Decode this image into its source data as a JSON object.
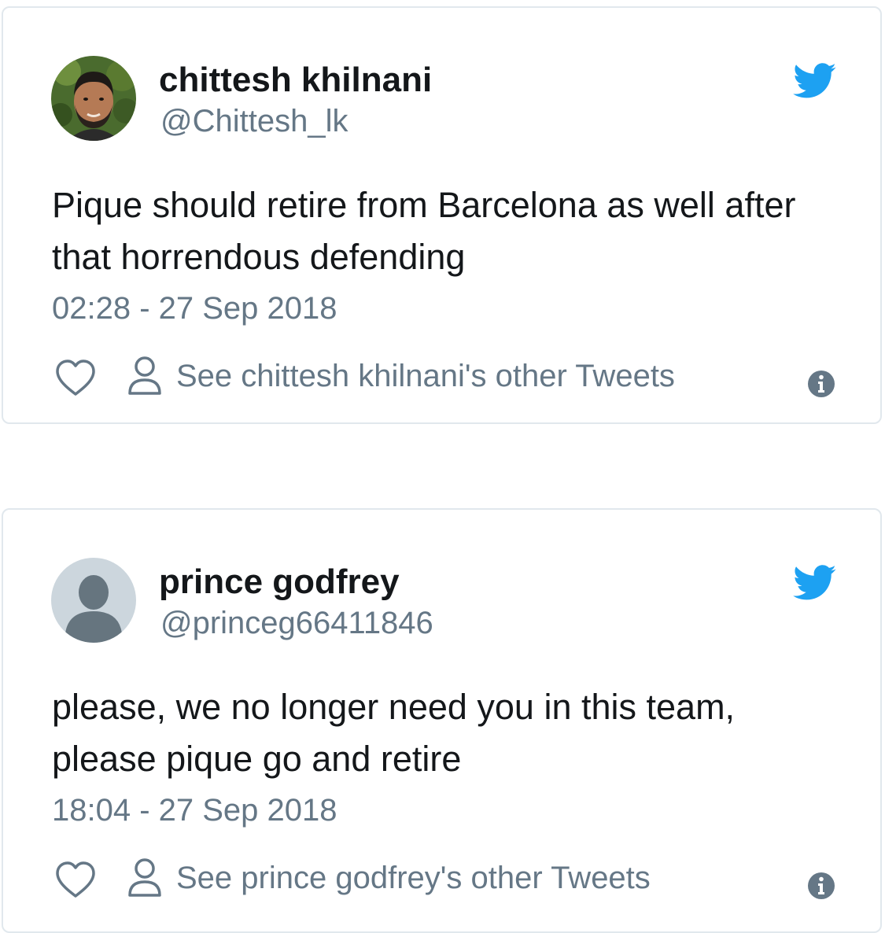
{
  "tweets": [
    {
      "display_name": "chittesh khilnani",
      "handle": "@Chittesh_lk",
      "text": "Pique should retire from Barcelona as well after that horrendous defending",
      "timestamp": "02:28 - 27 Sep 2018",
      "profile_link": "See chittesh khilnani's other Tweets"
    },
    {
      "display_name": "prince godfrey",
      "handle": "@princeg66411846",
      "text": "please, we no longer need you in this team, please pique go and retire",
      "timestamp": "18:04 - 27 Sep 2018",
      "profile_link": "See prince godfrey's other Tweets"
    }
  ],
  "icons": {
    "brand": "twitter-bird-icon",
    "like": "heart-icon",
    "profile": "person-icon",
    "info": "info-icon"
  },
  "colors": {
    "twitter_blue": "#1da1f2",
    "text_primary": "#14171a",
    "text_secondary": "#657786",
    "border": "#e1e8ed",
    "default_avatar_bg": "#ccd6dd",
    "default_avatar_fg": "#66757f"
  }
}
